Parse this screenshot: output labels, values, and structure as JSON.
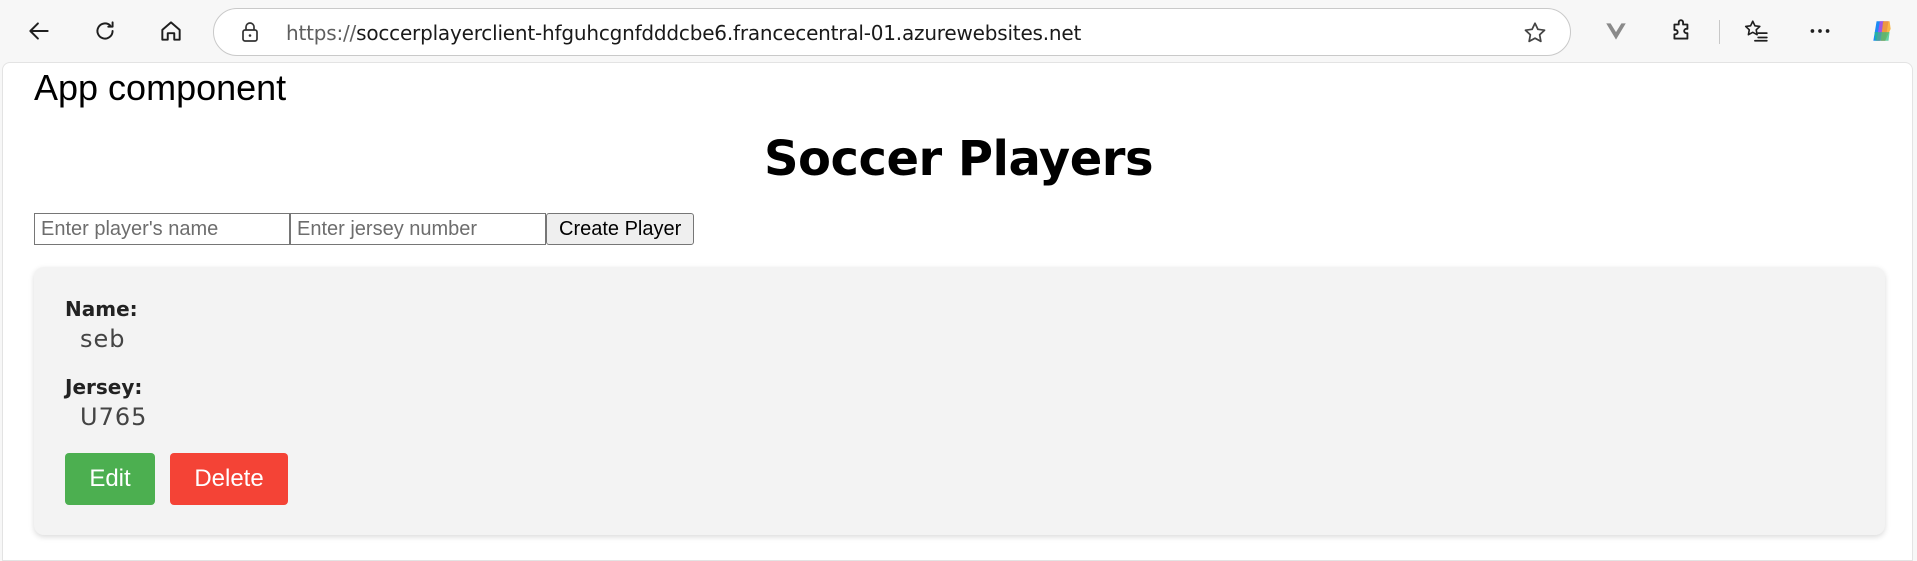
{
  "browser": {
    "url_scheme": "https://",
    "url_host": "soccerplayerclient-hfguhcgnfdddcbe6.francecentral-01.azurewebsites.net"
  },
  "app": {
    "component_label": "App component",
    "title": "Soccer Players",
    "form": {
      "name_placeholder": "Enter player's name",
      "jersey_placeholder": "Enter jersey number",
      "create_label": "Create Player"
    },
    "players": [
      {
        "name_label": "Name:",
        "name": "seb",
        "jersey_label": "Jersey:",
        "jersey": "U765",
        "edit_label": "Edit",
        "delete_label": "Delete"
      }
    ]
  },
  "colors": {
    "edit_button": "#4caf50",
    "delete_button": "#f44336",
    "card_background": "#f3f3f3"
  }
}
